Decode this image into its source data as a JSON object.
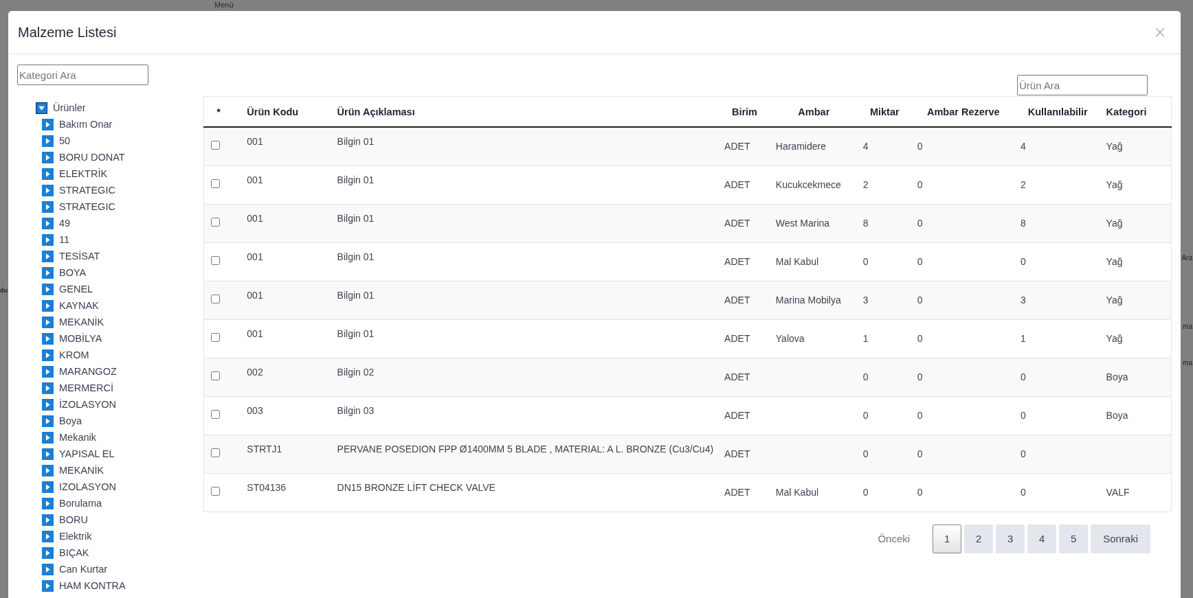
{
  "background": {
    "menu_label": "Menü",
    "right_edge_texts": [
      "Ara",
      "ma",
      "ma"
    ],
    "left_edge_texts": [
      "du"
    ]
  },
  "dialog": {
    "title": "Malzeme Listesi",
    "close_label": "×"
  },
  "category_search": {
    "placeholder": "Kategori Ara"
  },
  "tree": {
    "label": "Ürünler",
    "expanded": true,
    "children": [
      {
        "label": "Bakım Onar",
        "expanded": false
      },
      {
        "label": "50",
        "expanded": false
      },
      {
        "label": "BORU DONAT",
        "expanded": false
      },
      {
        "label": "ELEKTRİK",
        "expanded": false
      },
      {
        "label": "STRATEGIC",
        "expanded": false
      },
      {
        "label": "STRATEGIC",
        "expanded": false
      },
      {
        "label": "49",
        "expanded": false
      },
      {
        "label": "11",
        "expanded": false
      },
      {
        "label": "TESİSAT",
        "expanded": false
      },
      {
        "label": "BOYA",
        "expanded": false
      },
      {
        "label": "GENEL",
        "expanded": false
      },
      {
        "label": "KAYNAK",
        "expanded": false
      },
      {
        "label": "MEKANİK",
        "expanded": false
      },
      {
        "label": "MOBİLYA",
        "expanded": false
      },
      {
        "label": "KROM",
        "expanded": false
      },
      {
        "label": "MARANGOZ",
        "expanded": false
      },
      {
        "label": "MERMERCİ",
        "expanded": false
      },
      {
        "label": "İZOLASYON",
        "expanded": false
      },
      {
        "label": "Boya",
        "expanded": false
      },
      {
        "label": "Mekanik",
        "expanded": false
      },
      {
        "label": "YAPISAL EL",
        "expanded": false
      },
      {
        "label": "MEKANİK",
        "expanded": false
      },
      {
        "label": "IZOLASYON",
        "expanded": false
      },
      {
        "label": "Borulama",
        "expanded": false
      },
      {
        "label": "BORU",
        "expanded": false
      },
      {
        "label": "Elektrik",
        "expanded": false
      },
      {
        "label": "BIÇAK",
        "expanded": false
      },
      {
        "label": "Can Kurtar",
        "expanded": false
      },
      {
        "label": "HAM KONTRA",
        "expanded": false
      }
    ]
  },
  "product_search": {
    "placeholder": "Ürün Ara"
  },
  "table": {
    "select_column_header": "*",
    "columns": [
      "Ürün Kodu",
      "Ürün Açıklaması",
      "Birim",
      "Ambar",
      "Miktar",
      "Ambar Rezerve",
      "Kullanılabilir",
      "Kategori"
    ],
    "rows": [
      {
        "checked": false,
        "cells": [
          "001",
          "Bilgin 01",
          "ADET",
          "Haramidere",
          "4",
          "0",
          "4",
          "Yağ"
        ]
      },
      {
        "checked": false,
        "cells": [
          "001",
          "Bilgin 01",
          "ADET",
          "Kucukcekmece",
          "2",
          "0",
          "2",
          "Yağ"
        ]
      },
      {
        "checked": false,
        "cells": [
          "001",
          "Bilgin 01",
          "ADET",
          "West Marina",
          "8",
          "0",
          "8",
          "Yağ"
        ]
      },
      {
        "checked": false,
        "cells": [
          "001",
          "Bilgin 01",
          "ADET",
          "Mal Kabul",
          "0",
          "0",
          "0",
          "Yağ"
        ]
      },
      {
        "checked": false,
        "cells": [
          "001",
          "Bilgin 01",
          "ADET",
          "Marina Mobilya",
          "3",
          "0",
          "3",
          "Yağ"
        ]
      },
      {
        "checked": false,
        "cells": [
          "001",
          "Bilgin 01",
          "ADET",
          "Yalova",
          "1",
          "0",
          "1",
          "Yağ"
        ]
      },
      {
        "checked": false,
        "cells": [
          "002",
          "Bilgin 02",
          "ADET",
          "",
          "0",
          "0",
          "0",
          "Boya"
        ]
      },
      {
        "checked": false,
        "cells": [
          "003",
          "Bilgin 03",
          "ADET",
          "",
          "0",
          "0",
          "0",
          "Boya"
        ]
      },
      {
        "checked": false,
        "cells": [
          "STRTJ1",
          "PERVANE POSEDION FPP Ø1400MM 5 BLADE , MATERIAL: A L. BRONZE (Cu3/Cu4)",
          "ADET",
          "",
          "0",
          "0",
          "0",
          ""
        ]
      },
      {
        "checked": false,
        "cells": [
          "ST04136",
          "DN15 BRONZE LİFT CHECK VALVE",
          "ADET",
          "Mal Kabul",
          "0",
          "0",
          "0",
          "VALF"
        ]
      }
    ]
  },
  "pagination": {
    "previous": {
      "label": "Önceki",
      "disabled": true
    },
    "pages": [
      {
        "label": "1",
        "selected": true
      },
      {
        "label": "2",
        "selected": false
      },
      {
        "label": "3",
        "selected": false
      },
      {
        "label": "4",
        "selected": false
      },
      {
        "label": "5",
        "selected": false
      }
    ],
    "next": {
      "label": "Sonraki",
      "disabled": false
    }
  }
}
